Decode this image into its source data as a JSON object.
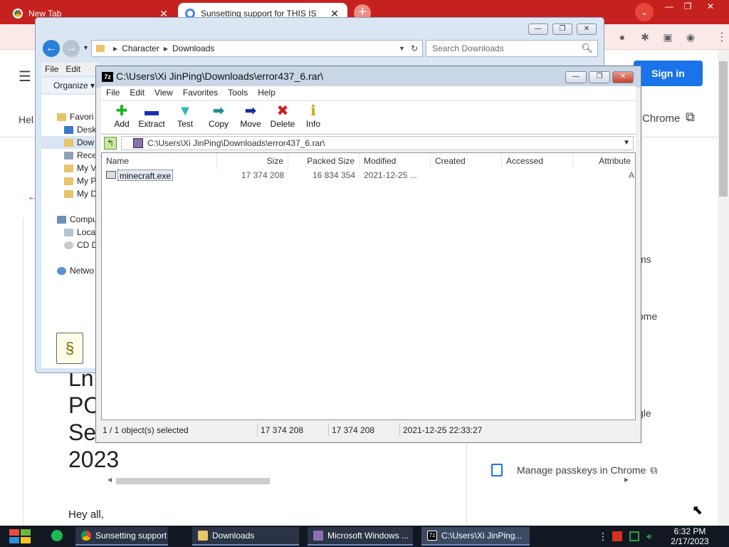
{
  "chrome": {
    "tabs": [
      {
        "label": "New Tab",
        "close": "✕"
      },
      {
        "label": "Sunsetting support for THIS IS",
        "close": "✕"
      }
    ],
    "new_tab": "+",
    "tab_search": "⌄",
    "window_controls": [
      "—",
      "❐",
      "✕"
    ],
    "page": {
      "hamburger": "☰",
      "signin": "Sign in",
      "help": "Hel",
      "chrome_link": "Chrome",
      "ext_link_icon": "⧉",
      "back": "←",
      "title": "Enc\nPO\nSe\n2023",
      "title_line1": "Ln",
      "title_line2": "PO",
      "title_line3": "Se",
      "title_line4": "2023",
      "greeting": "Hey all,",
      "side_fragments": [
        "ms",
        "ome",
        "gle"
      ],
      "manage_passkeys": "Manage passkeys in Chrome"
    }
  },
  "explorer": {
    "window_controls": [
      "—",
      "❐",
      "✕"
    ],
    "breadcrumb": [
      "Character",
      "Downloads"
    ],
    "search_placeholder": "Search Downloads",
    "menu": [
      "File",
      "Edit"
    ],
    "organize": "Organize ▾",
    "nav": [
      {
        "label": "Favori",
        "color": "#e9c46a"
      },
      {
        "label": "Desk",
        "color": "#3a78c9"
      },
      {
        "label": "Dow",
        "color": "#e9c46a"
      },
      {
        "label": "Rece",
        "color": "#8fa3b8"
      },
      {
        "label": "My V",
        "color": "#e9c46a"
      },
      {
        "label": "My P",
        "color": "#e9c46a"
      },
      {
        "label": "My D",
        "color": "#e9c46a"
      },
      {
        "label": "Compu",
        "color": "#6c8fb8"
      },
      {
        "label": "Loca",
        "color": "#b5c4d4"
      },
      {
        "label": "CD D",
        "color": "#c8c8c8"
      },
      {
        "label": "Netwo",
        "color": "#5b8fd0"
      }
    ]
  },
  "sevenzip": {
    "title": "C:\\Users\\Xi JinPing\\Downloads\\error437_6.rar\\",
    "app_icon": "7z",
    "window_controls": [
      "—",
      "❐",
      "✕"
    ],
    "menu": [
      "File",
      "Edit",
      "View",
      "Favorites",
      "Tools",
      "Help"
    ],
    "toolbar": [
      {
        "label": "Add",
        "icon": "✚",
        "color": "#1db31d"
      },
      {
        "label": "Extract",
        "icon": "▬",
        "color": "#1a2fb8"
      },
      {
        "label": "Test",
        "icon": "▼",
        "color": "#2bb6c9"
      },
      {
        "label": "Copy",
        "icon": "➡",
        "color": "#1f8f8f"
      },
      {
        "label": "Move",
        "icon": "➡",
        "color": "#1a2fa0"
      },
      {
        "label": "Delete",
        "icon": "✖",
        "color": "#d21c1c"
      },
      {
        "label": "Info",
        "icon": "ℹ",
        "color": "#c9a400"
      }
    ],
    "address": "C:\\Users\\Xi JinPing\\Downloads\\error437_6.rar\\",
    "columns": [
      "Name",
      "Size",
      "Packed Size",
      "Modified",
      "Created",
      "Accessed",
      "Attribute"
    ],
    "rows": [
      {
        "name": "minecraft.exe",
        "size": "17 374 208",
        "packed": "16 834 354",
        "modified": "2021-12-25 ...",
        "created": "",
        "accessed": "",
        "attr": "A"
      }
    ],
    "status": {
      "selected": "1 / 1 object(s) selected",
      "size": "17 374 208",
      "packed": "17 374 208",
      "modified": "2021-12-25 22:33:27"
    }
  },
  "taskbar": {
    "tasks": [
      {
        "label": "Sunsetting support ...",
        "color": "#e9c46a"
      },
      {
        "label": "Downloads",
        "color": "#e9c46a"
      },
      {
        "label": "Microsoft Windows ...",
        "color": "#8b6fb0"
      },
      {
        "label": "C:\\Users\\Xi JinPing...",
        "color": "#000000"
      }
    ],
    "tray_dots": "⋮",
    "time": "6:32 PM",
    "date": "2/17/2023"
  }
}
